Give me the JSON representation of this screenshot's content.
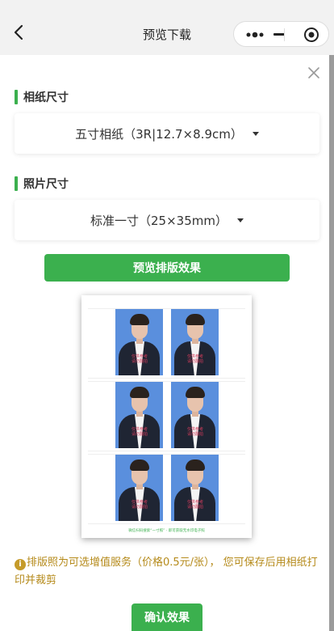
{
  "header": {
    "title": "预览下载"
  },
  "sections": {
    "paper": {
      "title": "相纸尺寸",
      "selected": "五寸相纸（3R|12.7×8.9cm）"
    },
    "photo": {
      "title": "照片尺寸",
      "selected": "标准一寸（25×35mm）"
    }
  },
  "preview_button": "预览排版效果",
  "sheet": {
    "watermark_line1": "仅供参考",
    "watermark_line2": "请勿翻拍",
    "footer_text": "微信扫码搜索“一寸照” · 即可获取无水印电子照"
  },
  "notice": {
    "icon": "i",
    "text": "排版照为可选增值服务（价格0.5元/张）， 您可保存后用相纸打印并裁剪"
  },
  "confirm_button": "确认效果",
  "colors": {
    "accent": "#3bb04e",
    "notice": "#b58a1a",
    "photo_bg": "#5a8fdd"
  },
  "icons": {
    "back": "chevron-left-icon",
    "more": "more-dots-icon",
    "minimize": "minus-icon",
    "capsule_close": "target-circle-icon",
    "close": "close-x-icon",
    "dropdown": "caret-down-icon",
    "info": "info-icon"
  }
}
